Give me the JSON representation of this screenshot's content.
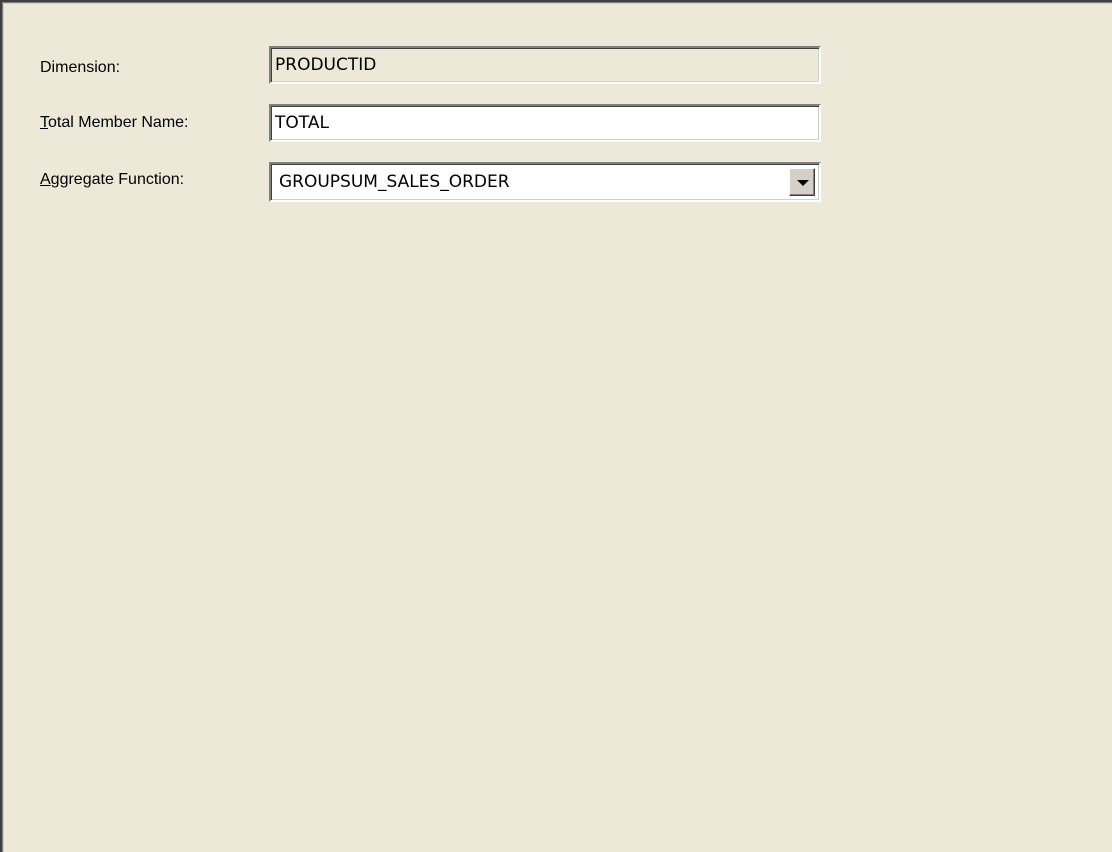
{
  "form": {
    "dimension": {
      "label": "Dimension:",
      "value": "PRODUCTID"
    },
    "total_member_name": {
      "label_accel": "T",
      "label_rest": "otal Member Name:",
      "value": "TOTAL"
    },
    "aggregate_function": {
      "label_accel": "A",
      "label_rest": "ggregate Function:",
      "value": "GROUPSUM_SALES_ORDER",
      "dropdown_icon": "chevron-down-icon"
    }
  }
}
